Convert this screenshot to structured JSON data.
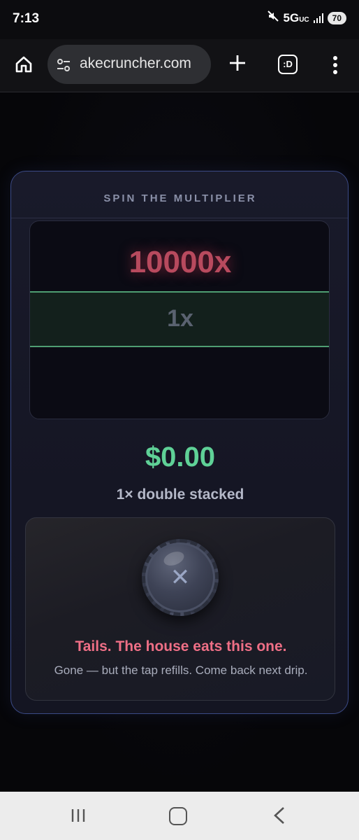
{
  "status_bar": {
    "time": "7:13",
    "network": "5G",
    "network_suffix": "UC",
    "battery": "70"
  },
  "browser": {
    "url": "akecruncher.com",
    "tabs_label": ":D"
  },
  "card": {
    "title": "SPIN THE MULTIPLIER",
    "reel_top_value": "10000x",
    "reel_selected_value": "1x",
    "amount": "$0.00",
    "stack_label": "1× double stacked",
    "result": {
      "coin_symbol": "✕",
      "title": "Tails. The house eats this one.",
      "subtitle": "Gone — but the tap refills. Come back next drip."
    }
  },
  "colors": {
    "accent_green": "#5fd197",
    "accent_red": "#ef6f86",
    "card_border": "#3b4a86"
  }
}
